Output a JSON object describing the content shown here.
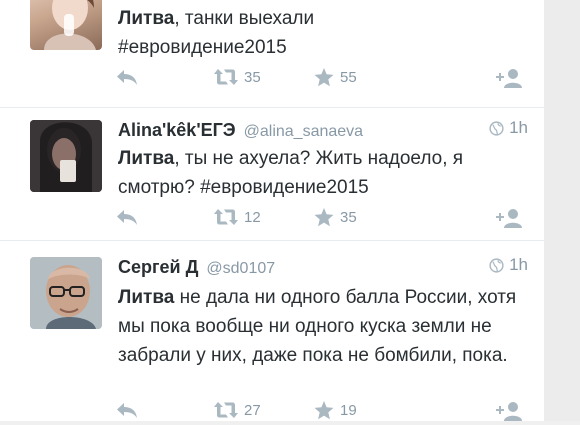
{
  "tweets": [
    {
      "name": "",
      "handle": "",
      "time": "",
      "mention": "Литва",
      "text": ", танки выехали\n#евровидение2015",
      "retweets": "35",
      "favorites": "55"
    },
    {
      "name": "Alina'kêk'ЕГЭ",
      "handle": "@alina_sanaeva",
      "time": "1h",
      "mention": "Литва",
      "text": ", ты не ахуела? Жить надоело, я смотрю? #евровидение2015",
      "retweets": "12",
      "favorites": "35"
    },
    {
      "name": "Сергей Д",
      "handle": "@sd0107",
      "time": "1h",
      "mention": "Литва",
      "text": " не дала ни одного балла России, хотя мы пока вообще ни одного куска земли не забрали у них, даже пока не бомбили, пока.",
      "retweets": "27",
      "favorites": "19"
    }
  ],
  "icons": {
    "reply": "reply-icon",
    "retweet": "retweet-icon",
    "favorite": "star-icon",
    "follow": "follow-icon",
    "globe": "globe-icon"
  },
  "colors": {
    "meta": "#8899a6",
    "text": "#292f33",
    "divider": "#e6ecf0"
  }
}
